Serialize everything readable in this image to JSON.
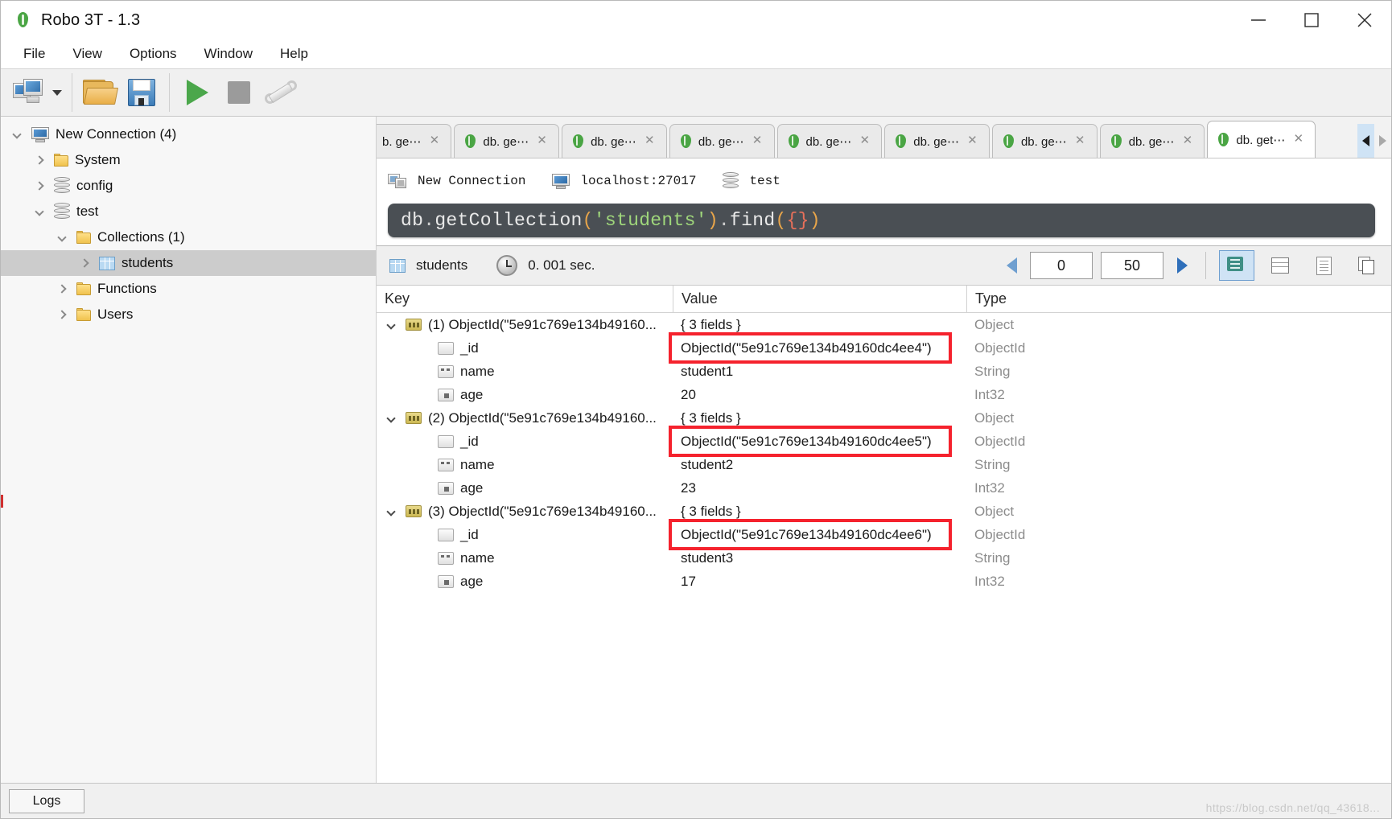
{
  "window": {
    "title": "Robo 3T - 1.3",
    "app_icon": "mongodb-leaf-icon",
    "controls": {
      "minimize": "minimize-icon",
      "maximize": "maximize-icon",
      "close": "close-icon"
    }
  },
  "menubar": {
    "items": [
      "File",
      "View",
      "Options",
      "Window",
      "Help"
    ]
  },
  "toolbar": {
    "buttons": [
      {
        "name": "connect-button",
        "icon": "connect-computers-icon"
      },
      {
        "name": "connect-dropdown",
        "icon": "chevron-down-icon"
      },
      {
        "name": "open-script-button",
        "icon": "folder-open-icon"
      },
      {
        "name": "save-script-button",
        "icon": "floppy-disk-icon"
      },
      {
        "name": "execute-button",
        "icon": "play-icon"
      },
      {
        "name": "stop-button",
        "icon": "stop-icon"
      },
      {
        "name": "options-button",
        "icon": "wrench-icon"
      }
    ]
  },
  "sidebar": {
    "items": [
      {
        "label": "New Connection (4)",
        "icon": "server-icon",
        "twisty": "open",
        "indent": 0,
        "selected": false
      },
      {
        "label": "System",
        "icon": "folder-icon",
        "twisty": "closed",
        "indent": 1,
        "selected": false
      },
      {
        "label": "config",
        "icon": "database-icon",
        "twisty": "closed",
        "indent": 1,
        "selected": false
      },
      {
        "label": "test",
        "icon": "database-icon",
        "twisty": "open",
        "indent": 1,
        "selected": false
      },
      {
        "label": "Collections (1)",
        "icon": "folder-icon",
        "twisty": "open",
        "indent": 2,
        "selected": false
      },
      {
        "label": "students",
        "icon": "collection-icon",
        "twisty": "closed",
        "indent": 3,
        "selected": true
      },
      {
        "label": "Functions",
        "icon": "folder-icon",
        "twisty": "closed",
        "indent": 2,
        "selected": false
      },
      {
        "label": "Users",
        "icon": "folder-icon",
        "twisty": "closed",
        "indent": 2,
        "selected": false
      }
    ]
  },
  "tabs": {
    "items": [
      {
        "label": "b. ge⋯",
        "active": false,
        "clipped": true
      },
      {
        "label": "db. ge⋯",
        "active": false,
        "clipped": false
      },
      {
        "label": "db. ge⋯",
        "active": false,
        "clipped": false
      },
      {
        "label": "db. ge⋯",
        "active": false,
        "clipped": false
      },
      {
        "label": "db. ge⋯",
        "active": false,
        "clipped": false
      },
      {
        "label": "db. ge⋯",
        "active": false,
        "clipped": false
      },
      {
        "label": "db. ge⋯",
        "active": false,
        "clipped": false
      },
      {
        "label": "db. ge⋯",
        "active": false,
        "clipped": false
      },
      {
        "label": "db. get⋯",
        "active": true,
        "clipped": false
      }
    ],
    "close_glyph": "✕",
    "nav_left": "scroll-tabs-left-icon",
    "nav_right": "scroll-tabs-right-icon"
  },
  "connection_bar": {
    "connection_name": "New Connection",
    "host": "localhost:27017",
    "database": "test"
  },
  "editor": {
    "tokens": [
      {
        "t": "db",
        "c": "w"
      },
      {
        "t": ".",
        "c": "dot"
      },
      {
        "t": "getCollection",
        "c": "w"
      },
      {
        "t": "(",
        "c": "par"
      },
      {
        "t": "'students'",
        "c": "str"
      },
      {
        "t": ")",
        "c": "par"
      },
      {
        "t": ".",
        "c": "dot"
      },
      {
        "t": "find",
        "c": "w"
      },
      {
        "t": "(",
        "c": "par"
      },
      {
        "t": "{}",
        "c": "brc"
      },
      {
        "t": ")",
        "c": "par"
      }
    ],
    "plain_text": "db.getCollection('students').find({})"
  },
  "results_toolbar": {
    "collection": "students",
    "time": "0. 001 sec.",
    "skip": "0",
    "limit": "50",
    "view_modes": [
      {
        "name": "tree-view-button",
        "icon": "tree-view-icon",
        "active": true
      },
      {
        "name": "table-view-button",
        "icon": "table-view-icon",
        "active": false
      },
      {
        "name": "text-view-button",
        "icon": "document-view-icon",
        "active": false
      },
      {
        "name": "copy-button",
        "icon": "copy-icon",
        "active": false
      }
    ]
  },
  "results": {
    "columns": [
      "Key",
      "Value",
      "Type"
    ],
    "rows": [
      {
        "key": "(1) ObjectId(\"5e91c769e134b49160...",
        "value": "{ 3 fields }",
        "type": "Object",
        "level": 0,
        "icon": "object-icon",
        "expanded": true
      },
      {
        "key": "_id",
        "value": "ObjectId(\"5e91c769e134b49160dc4ee4\")",
        "type": "ObjectId",
        "level": 1,
        "icon": "blank-field-icon",
        "highlight": true
      },
      {
        "key": "name",
        "value": "student1",
        "type": "String",
        "level": 1,
        "icon": "string-field-icon",
        "highlight": false
      },
      {
        "key": "age",
        "value": "20",
        "type": "Int32",
        "level": 1,
        "icon": "int-field-icon",
        "highlight": false
      },
      {
        "key": "(2) ObjectId(\"5e91c769e134b49160...",
        "value": "{ 3 fields }",
        "type": "Object",
        "level": 0,
        "icon": "object-icon",
        "expanded": true
      },
      {
        "key": "_id",
        "value": "ObjectId(\"5e91c769e134b49160dc4ee5\")",
        "type": "ObjectId",
        "level": 1,
        "icon": "blank-field-icon",
        "highlight": true
      },
      {
        "key": "name",
        "value": "student2",
        "type": "String",
        "level": 1,
        "icon": "string-field-icon",
        "highlight": false
      },
      {
        "key": "age",
        "value": "23",
        "type": "Int32",
        "level": 1,
        "icon": "int-field-icon",
        "highlight": false
      },
      {
        "key": "(3) ObjectId(\"5e91c769e134b49160...",
        "value": "{ 3 fields }",
        "type": "Object",
        "level": 0,
        "icon": "object-icon",
        "expanded": true
      },
      {
        "key": "_id",
        "value": "ObjectId(\"5e91c769e134b49160dc4ee6\")",
        "type": "ObjectId",
        "level": 1,
        "icon": "blank-field-icon",
        "highlight": true
      },
      {
        "key": "name",
        "value": "student3",
        "type": "String",
        "level": 1,
        "icon": "string-field-icon",
        "highlight": false
      },
      {
        "key": "age",
        "value": "17",
        "type": "Int32",
        "level": 1,
        "icon": "int-field-icon",
        "highlight": false
      }
    ]
  },
  "statusbar": {
    "logs_label": "Logs",
    "watermark": "https://blog.csdn.net/qq_43618..."
  },
  "colors": {
    "accent_blue": "#cfe3f5",
    "highlight_red": "#f5222d",
    "editor_bg": "#4a4f54",
    "mongo_green": "#4aa544",
    "selection_gray": "#cccccc"
  }
}
